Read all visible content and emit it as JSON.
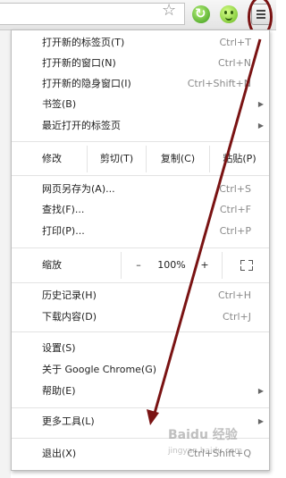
{
  "toolbar": {
    "star_icon": "star-icon",
    "extensions": [
      "refresh-extension-icon",
      "smiley-extension-icon"
    ],
    "menu_icon": "hamburger-menu-icon"
  },
  "menu": {
    "new_tab": {
      "label": "打开新的标签页(T)",
      "shortcut": "Ctrl+T"
    },
    "new_window": {
      "label": "打开新的窗口(N)",
      "shortcut": "Ctrl+N"
    },
    "new_incognito": {
      "label": "打开新的隐身窗口(I)",
      "shortcut": "Ctrl+Shift+N"
    },
    "bookmarks": {
      "label": "书签(B)"
    },
    "recent_tabs": {
      "label": "最近打开的标签页"
    },
    "edit": {
      "label": "修改",
      "cut": "剪切(T)",
      "copy": "复制(C)",
      "paste": "粘贴(P)"
    },
    "save_as": {
      "label": "网页另存为(A)...",
      "shortcut": "Ctrl+S"
    },
    "find": {
      "label": "查找(F)...",
      "shortcut": "Ctrl+F"
    },
    "print": {
      "label": "打印(P)...",
      "shortcut": "Ctrl+P"
    },
    "zoom": {
      "label": "缩放",
      "minus": "–",
      "value": "100%",
      "plus": "+"
    },
    "history": {
      "label": "历史记录(H)",
      "shortcut": "Ctrl+H"
    },
    "downloads": {
      "label": "下载内容(D)",
      "shortcut": "Ctrl+J"
    },
    "settings": {
      "label": "设置(S)"
    },
    "about": {
      "label": "关于 Google Chrome(G)"
    },
    "help": {
      "label": "帮助(E)"
    },
    "more_tools": {
      "label": "更多工具(L)"
    },
    "exit": {
      "label": "退出(X)",
      "shortcut": "Ctrl+Shift+Q"
    }
  },
  "watermark": {
    "line1": "Baidu 经验",
    "line2": "jingyan.baidu.com"
  },
  "annotation_color": "#7a1313"
}
